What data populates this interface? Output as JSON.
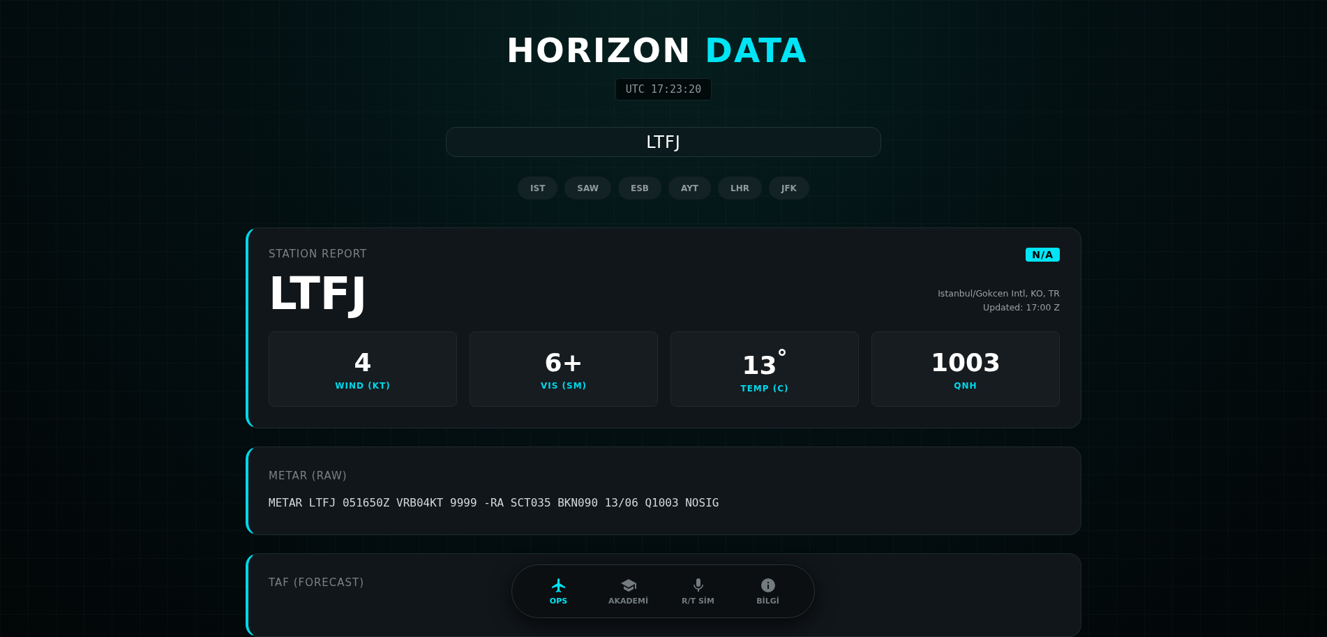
{
  "header": {
    "title_parts": [
      {
        "text": "HORIZON",
        "accent": false
      },
      {
        "text": "DATA",
        "accent": true
      }
    ],
    "clock": "UTC 17:23:20"
  },
  "search": {
    "value": "LTFJ"
  },
  "quick_stations": [
    "IST",
    "SAW",
    "ESB",
    "AYT",
    "LHR",
    "JFK"
  ],
  "station_report": {
    "heading": "STATION REPORT",
    "badge": "N/A",
    "code": "LTFJ",
    "location": "Istanbul/Gokcen Intl, KO, TR",
    "updated": "Updated: 17:00 Z",
    "stats": [
      {
        "value": "4",
        "label": "WIND (KT)"
      },
      {
        "value": "6+",
        "label": "VIS (SM)"
      },
      {
        "value": "13$^{°}$",
        "label": "TEMP (C)"
      },
      {
        "value": "1003",
        "label": "QNH"
      }
    ]
  },
  "metar": {
    "heading": "METAR (RAW)",
    "text": "METAR LTFJ 051650Z VRB04KT 9999 -RA SCT035 BKN090 13/06 Q1003 NOSIG"
  },
  "taf": {
    "heading": "TAF (FORECAST)"
  },
  "nav": [
    {
      "kind": "plane",
      "label": "OPS",
      "selected": true
    },
    {
      "kind": "cap",
      "label": "AKADEMİ",
      "selected": false
    },
    {
      "kind": "mic",
      "label": "R/T SİM",
      "selected": false
    },
    {
      "kind": "info",
      "label": "BİLGİ",
      "selected": false
    }
  ]
}
